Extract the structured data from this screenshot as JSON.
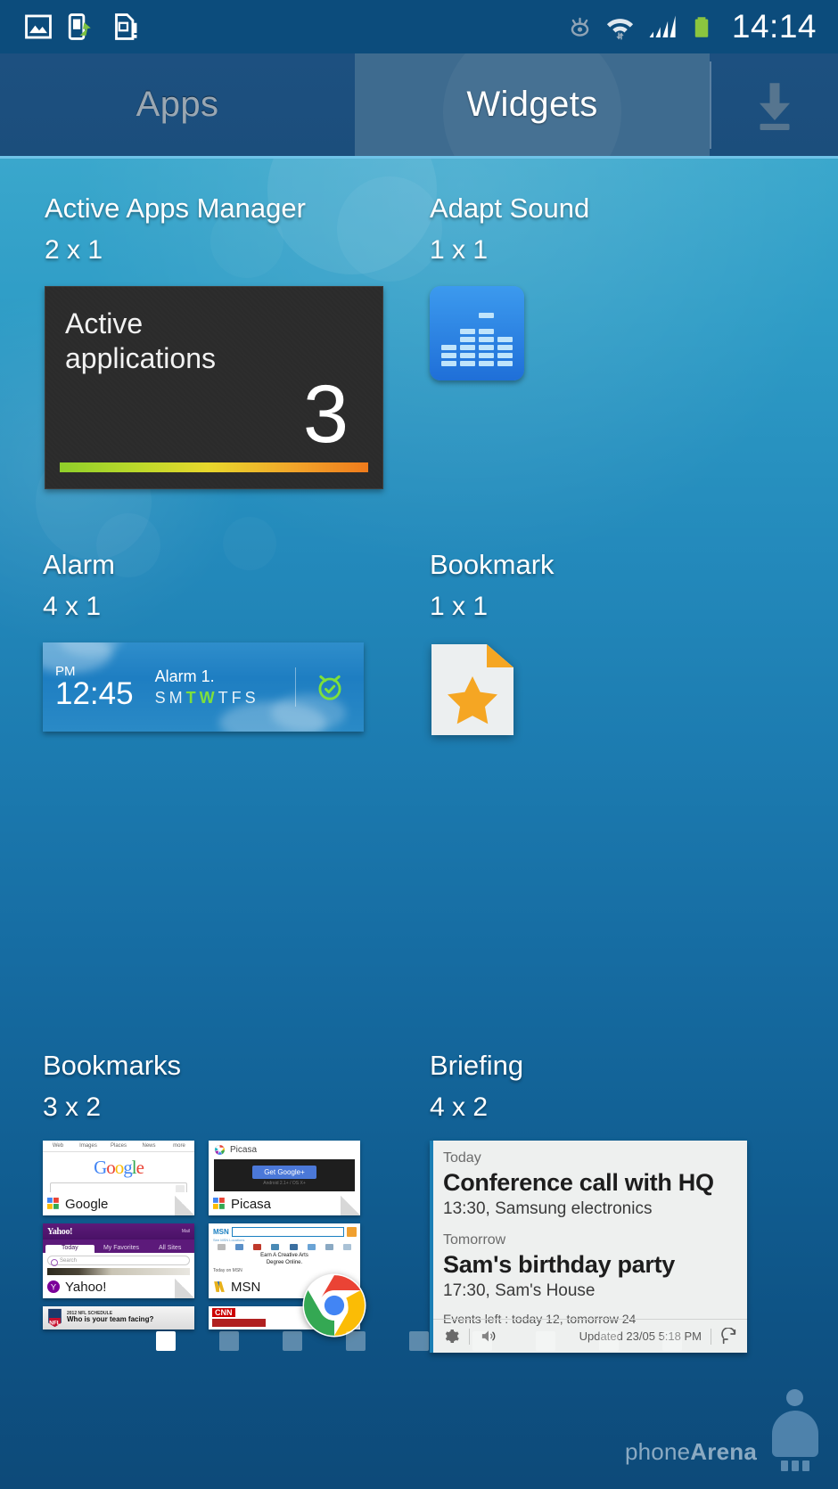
{
  "statusbar": {
    "time": "14:14",
    "icons": [
      "image-icon",
      "phone-transfer-icon",
      "sim-card-alert-icon",
      "eye-smart-stay-icon",
      "wifi-icon",
      "signal-icon",
      "battery-icon"
    ]
  },
  "tabs": {
    "apps_label": "Apps",
    "widgets_label": "Widgets",
    "active": "Widgets",
    "download_icon": "download-icon"
  },
  "widgets": [
    {
      "id": "active-apps-manager",
      "title": "Active Apps Manager",
      "size": "2 x 1",
      "preview": {
        "line1": "Active",
        "line2": "applications",
        "count": "3"
      }
    },
    {
      "id": "adapt-sound",
      "title": "Adapt Sound",
      "size": "1 x 1",
      "preview": {
        "icon": "equalizer-icon"
      }
    },
    {
      "id": "alarm",
      "title": "Alarm",
      "size": "4 x 1",
      "preview": {
        "meridiem": "PM",
        "time": "12:45",
        "name": "Alarm 1.",
        "days": [
          "S",
          "M",
          "T",
          "W",
          "T",
          "F",
          "S"
        ],
        "days_active": [
          2,
          3
        ],
        "icon": "alarm-clock-icon"
      }
    },
    {
      "id": "bookmark",
      "title": "Bookmark",
      "size": "1 x 1",
      "preview": {
        "icon": "bookmark-star-page-icon"
      }
    },
    {
      "id": "bookmarks",
      "title": "Bookmarks",
      "size": "3 x 2",
      "preview": {
        "items": [
          {
            "label": "Google",
            "tabs": [
              "Web",
              "Images",
              "Places",
              "News",
              "more"
            ]
          },
          {
            "label": "Picasa",
            "button": "Get Google+",
            "caption": "Android 2.1+ / OS X+"
          },
          {
            "label": "Yahoo!",
            "tabs": [
              "Today",
              "My Favorites",
              "All Sites"
            ],
            "search": "Search",
            "corner": "Mail"
          },
          {
            "label": "MSN",
            "subnav": "See MSN Locations",
            "ad_line1": "Earn A Creative Arts",
            "ad_line2": "Degree Online.",
            "today": "Today on MSN"
          },
          {
            "label": "NFL",
            "headline1": "2012 NFL SCHEDULE",
            "headline2": "Who is your team facing?"
          },
          {
            "label": "CNN"
          }
        ],
        "chrome_icon": "chrome-icon"
      }
    },
    {
      "id": "briefing",
      "title": "Briefing",
      "size": "4 x 2",
      "preview": {
        "events": [
          {
            "day": "Today",
            "title": "Conference call with HQ",
            "meta": "13:30, Samsung electronics"
          },
          {
            "day": "Tomorrow",
            "title": "Sam's birthday party",
            "meta": "17:30, Sam's House"
          }
        ],
        "events_left": "Events left : today 12, tomorrow 24",
        "updated": "Updated 23/05 5:18 PM",
        "footer_icons": [
          "settings-gear-icon",
          "news-speaker-icon",
          "refresh-icon"
        ]
      }
    }
  ],
  "pagination": {
    "total": 9,
    "active_index": 0
  },
  "watermark": {
    "text_light": "phone",
    "text_bold": "Arena"
  }
}
